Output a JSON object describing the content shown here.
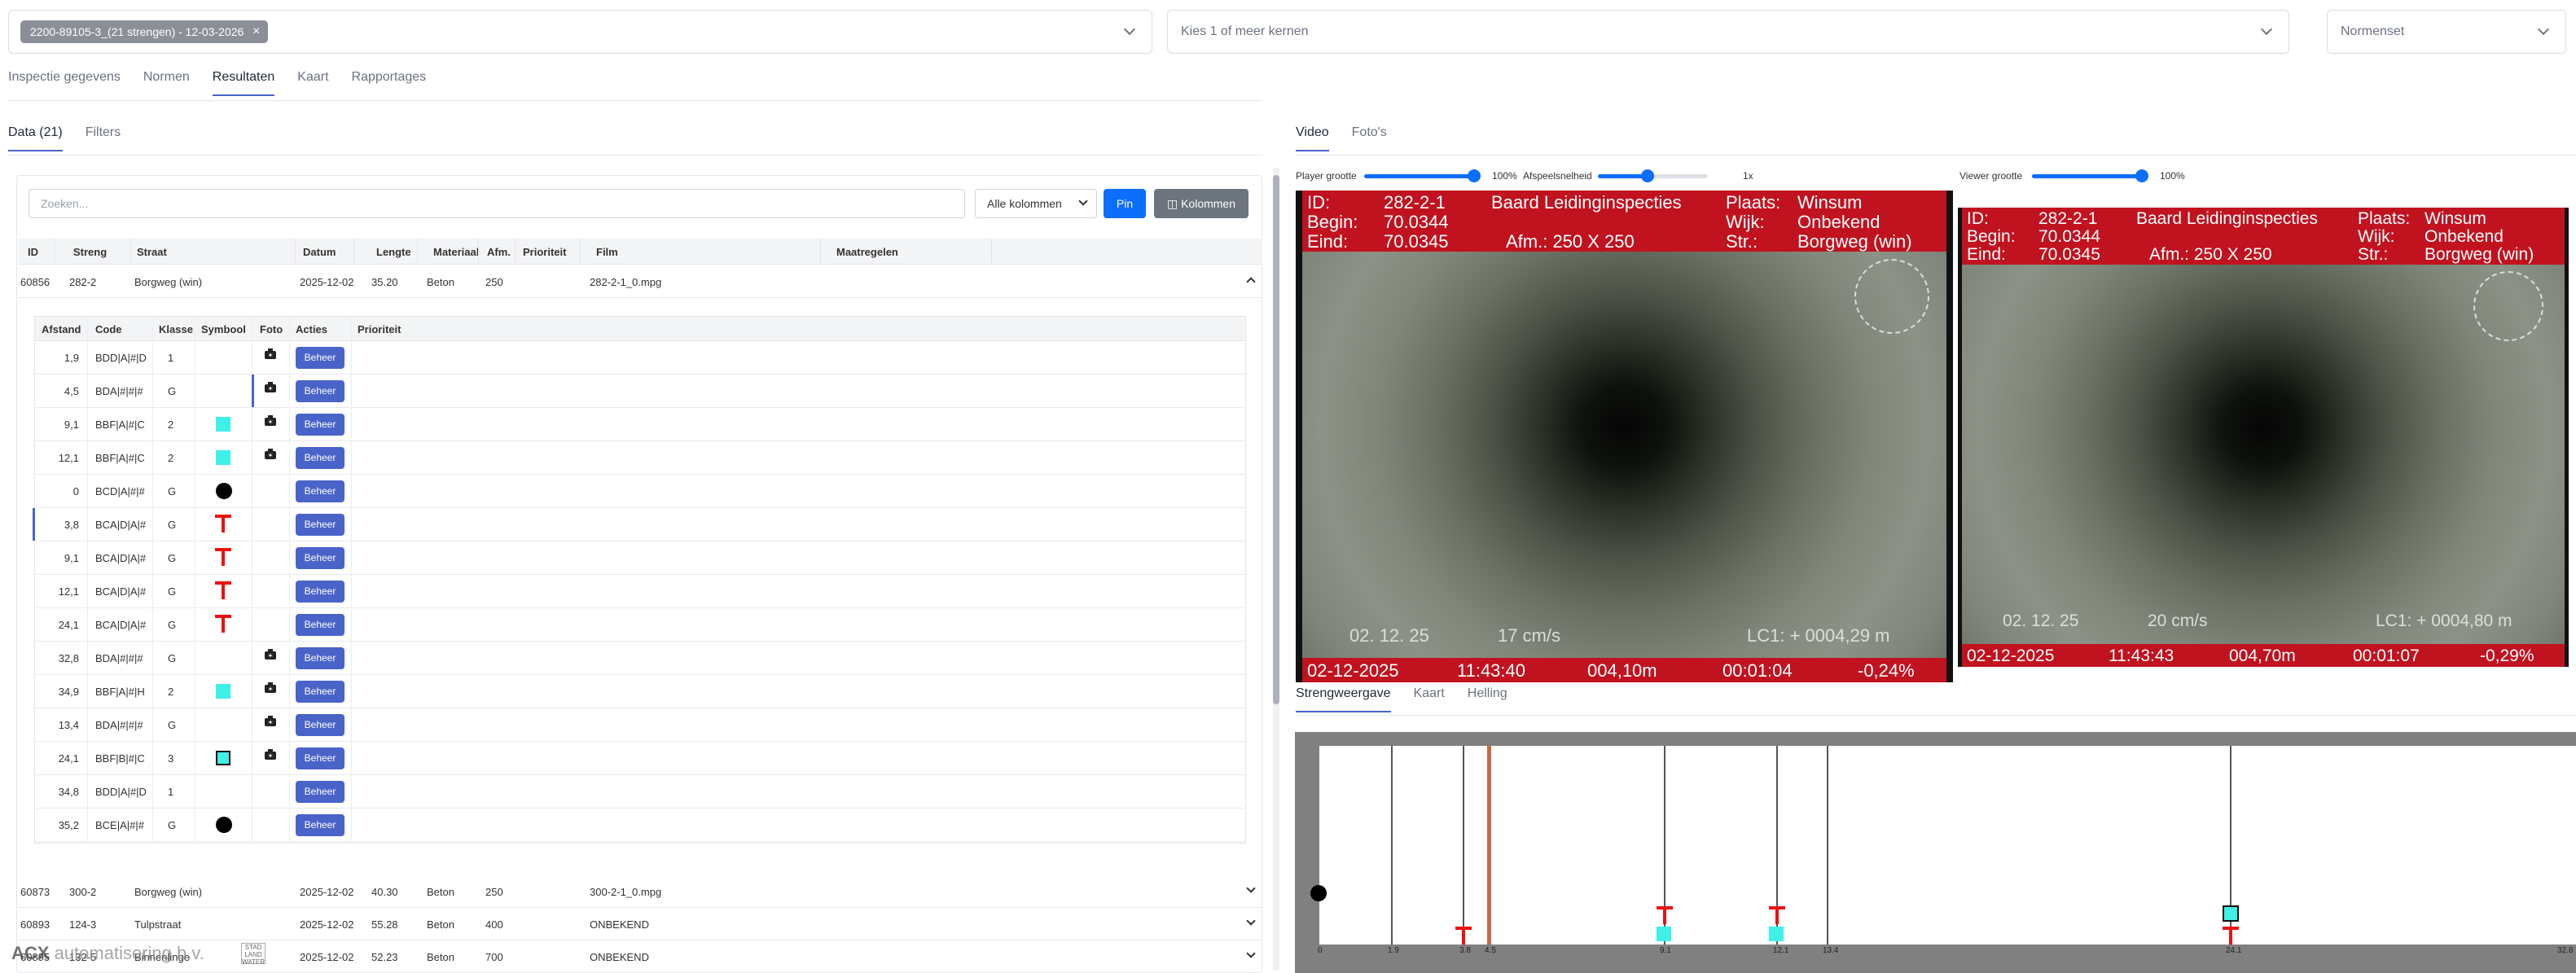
{
  "top": {
    "chip_label": "2200-89105-3_(21 strengen) - 12-03-2026",
    "chip_close": "×",
    "cores_placeholder": "Kies 1 of meer kernen",
    "normset_placeholder": "Normenset"
  },
  "main_tabs": [
    "Inspectie gegevens",
    "Normen",
    "Resultaten",
    "Kaart",
    "Rapportages"
  ],
  "data_tabs": [
    "Data (21)",
    "Filters"
  ],
  "search": {
    "placeholder": "Zoeken..."
  },
  "column_select": "Alle kolommen",
  "pin_label": "Pin",
  "columns_label": "◫ Kolommen",
  "table": {
    "headers": [
      "ID",
      "Streng",
      "Straat",
      "Datum",
      "Lengte",
      "Materiaal",
      "Afm.",
      "Prioriteit",
      "Film",
      "Maatregelen"
    ],
    "rows": [
      {
        "id": "60856",
        "streng": "282-2",
        "straat": "Borgweg (win)",
        "datum": "2025-12-02",
        "lengte": "35.20",
        "materiaal": "Beton",
        "afm": "250",
        "film": "282-2-1_0.mpg"
      },
      {
        "id": "60873",
        "streng": "300-2",
        "straat": "Borgweg (win)",
        "datum": "2025-12-02",
        "lengte": "40.30",
        "materiaal": "Beton",
        "afm": "250",
        "film": "300-2-1_0.mpg"
      },
      {
        "id": "60893",
        "streng": "124-3",
        "straat": "Tulpstraat",
        "datum": "2025-12-02",
        "lengte": "55.28",
        "materiaal": "Beton",
        "afm": "400",
        "film": "ONBEKEND"
      },
      {
        "id": "60895",
        "streng": "132-5",
        "straat": "Binnenlinge",
        "datum": "2025-12-02",
        "lengte": "52.23",
        "materiaal": "Beton",
        "afm": "700",
        "film": "ONBEKEND"
      }
    ]
  },
  "sub_table": {
    "headers": [
      "Afstand",
      "Code",
      "Klasse",
      "Symbool",
      "Foto",
      "Acties",
      "Prioriteit"
    ],
    "action_label": "Beheer",
    "rows": [
      {
        "afstand": "1,9",
        "code": "BDD|A|#|D",
        "klasse": "1",
        "symbol": "none",
        "foto": true
      },
      {
        "afstand": "4,5",
        "code": "BDA|#|#|#",
        "klasse": "G",
        "symbol": "none",
        "foto": true
      },
      {
        "afstand": "9,1",
        "code": "BBF|A|#|C",
        "klasse": "2",
        "symbol": "square",
        "foto": true
      },
      {
        "afstand": "12,1",
        "code": "BBF|A|#|C",
        "klasse": "2",
        "symbol": "square",
        "foto": true
      },
      {
        "afstand": "0",
        "code": "BCD|A|#|#",
        "klasse": "G",
        "symbol": "dot",
        "foto": false
      },
      {
        "afstand": "3,8",
        "code": "BCA|D|A|#",
        "klasse": "G",
        "symbol": "tee",
        "foto": false
      },
      {
        "afstand": "9,1",
        "code": "BCA|D|A|#",
        "klasse": "G",
        "symbol": "tee",
        "foto": false
      },
      {
        "afstand": "12,1",
        "code": "BCA|D|A|#",
        "klasse": "G",
        "symbol": "tee",
        "foto": false
      },
      {
        "afstand": "24,1",
        "code": "BCA|D|A|#",
        "klasse": "G",
        "symbol": "tee",
        "foto": false
      },
      {
        "afstand": "32,8",
        "code": "BDA|#|#|#",
        "klasse": "G",
        "symbol": "none",
        "foto": true
      },
      {
        "afstand": "34,9",
        "code": "BBF|A|#|H",
        "klasse": "2",
        "symbol": "square",
        "foto": true
      },
      {
        "afstand": "13,4",
        "code": "BDA|#|#|#",
        "klasse": "G",
        "symbol": "none",
        "foto": true
      },
      {
        "afstand": "24,1",
        "code": "BBF|B|#|C",
        "klasse": "3",
        "symbol": "square-bordered",
        "foto": true
      },
      {
        "afstand": "34,8",
        "code": "BDD|A|#|D",
        "klasse": "1",
        "symbol": "none",
        "foto": false
      },
      {
        "afstand": "35,2",
        "code": "BCE|A|#|#",
        "klasse": "G",
        "symbol": "dot",
        "foto": false
      }
    ]
  },
  "footer": {
    "brand": "ACX",
    "company": "automatisering b.v.",
    "logo_text": "STAD LAND WATER"
  },
  "video_tabs": [
    "Video",
    "Foto's"
  ],
  "sliders": {
    "player_label": "Player grootte",
    "player_value": "100%",
    "player_level": 1.0,
    "speed_label": "Afspeelsnelheid",
    "speed_value": "1x",
    "speed_level": 0.45,
    "viewer_label": "Viewer grootte",
    "viewer_value": "100%",
    "viewer_level": 1.0
  },
  "video1": {
    "id_label": "ID:",
    "id": "282-2-1",
    "begin_label": "Begin:",
    "begin": "70.0344",
    "end_label": "Eind:",
    "end": "70.0345",
    "company": "Baard Leidinginspecties",
    "afm": "Afm.:  250   X   250",
    "place_label": "Plaats:",
    "place": "Winsum",
    "wijk_label": "Wijk:",
    "wijk": "Onbekend",
    "str_label": "Str.:",
    "str": "Borgweg (win)",
    "overlay_date": "02. 12. 25",
    "overlay_speed": "17  cm/s",
    "overlay_lc": "LC1: + 0004,29  m",
    "bottom_date": "02-12-2025",
    "bottom_time": "11:43:40",
    "bottom_dist": "004,10m",
    "bottom_elapsed": "00:01:04",
    "bottom_incl": "-0,24%"
  },
  "video2": {
    "id_label": "ID:",
    "id": "282-2-1",
    "begin_label": "Begin:",
    "begin": "70.0344",
    "end_label": "Eind:",
    "end": "70.0345",
    "company": "Baard Leidinginspecties",
    "afm": "Afm.:  250   X   250",
    "place_label": "Plaats:",
    "place": "Winsum",
    "wijk_label": "Wijk:",
    "wijk": "Onbekend",
    "str_label": "Str.:",
    "str": "Borgweg (win)",
    "overlay_date": "02. 12. 25",
    "overlay_speed": "20  cm/s",
    "overlay_lc": "LC1: + 0004,80  m",
    "bottom_date": "02-12-2025",
    "bottom_time": "11:43:43",
    "bottom_dist": "004,70m",
    "bottom_elapsed": "00:01:07",
    "bottom_incl": "-0,29%"
  },
  "strip_tabs": [
    "Strengweergave",
    "Kaart",
    "Helling"
  ],
  "strip_ticks": [
    "0",
    "1.9",
    "3.8",
    "4.5",
    "9.1",
    "12.1",
    "13.4",
    "24.1",
    "32.8"
  ]
}
